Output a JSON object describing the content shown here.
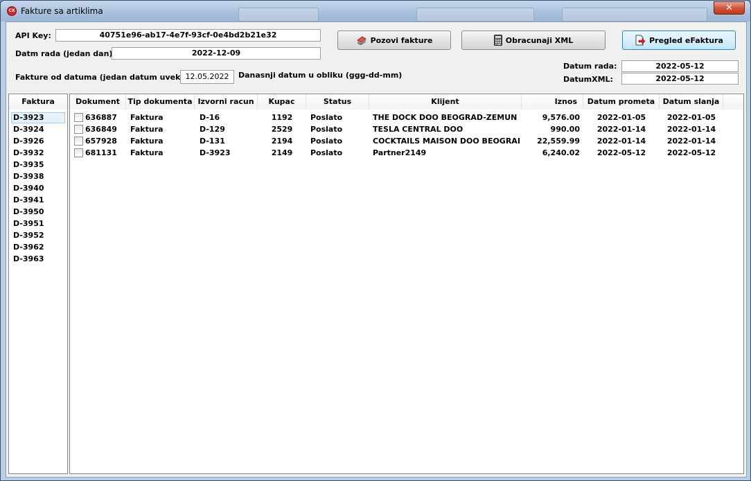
{
  "window": {
    "title": "Fakture sa artiklima",
    "close_symbol": "✕"
  },
  "form": {
    "api_key_label": "API Key:",
    "api_key_value": "40751e96-ab17-4e7f-93cf-0e4bd2b21e32",
    "datum_rada_label": "Datm rada (jedan dan)",
    "datum_rada_value": "2022-12-09",
    "fakture_od_label": "Fakture od datuma (jedan datum uvek):",
    "fakture_od_value": "12.05.2022",
    "danasnji_hint": "Danasnji datum u obliku (ggg-dd-mm)"
  },
  "toolbar": {
    "pozovi_label": "Pozovi fakture",
    "obracunaj_label": "Obracunaji XML",
    "pregled_label": "Pregled eFaktura"
  },
  "info": {
    "datum_rada_label": "Datum rada:",
    "datum_rada_value": "2022-05-12",
    "datum_xml_label": "DatumXML:",
    "datum_xml_value": "2022-05-12"
  },
  "faktura_list": {
    "header": "Faktura",
    "selected_index": 0,
    "items": [
      "D-3923",
      "D-3924",
      "D-3926",
      "D-3932",
      "D-3935",
      "D-3938",
      "D-3940",
      "D-3941",
      "D-3950",
      "D-3951",
      "D-3952",
      "D-3962",
      "D-3963"
    ]
  },
  "grid": {
    "columns": [
      "Dokument",
      "Tip dokumenta",
      "Izvorni racun",
      "Kupac",
      "Status",
      "Klijent",
      "Iznos",
      "Datum prometa",
      "Datum slanja"
    ],
    "rows": [
      {
        "checked": false,
        "dokument": "636887",
        "tip": "Faktura",
        "izvorni": "D-16",
        "kupac": "1192",
        "status": "Poslato",
        "klijent": "THE DOCK DOO BEOGRAD-ZEMUN",
        "iznos": "9,576.00",
        "prometa": "2022-01-05",
        "slanja": "2022-01-05"
      },
      {
        "checked": false,
        "dokument": "636849",
        "tip": "Faktura",
        "izvorni": "D-129",
        "kupac": "2529",
        "status": "Poslato",
        "klijent": "TESLA CENTRAL DOO",
        "iznos": "990.00",
        "prometa": "2022-01-14",
        "slanja": "2022-01-14"
      },
      {
        "checked": false,
        "dokument": "657928",
        "tip": "Faktura",
        "izvorni": "D-131",
        "kupac": "2194",
        "status": "Poslato",
        "klijent": "COCKTAILS MAISON DOO BEOGRAD...",
        "iznos": "22,559.99",
        "prometa": "2022-01-14",
        "slanja": "2022-01-14"
      },
      {
        "checked": false,
        "dokument": "681131",
        "tip": "Faktura",
        "izvorni": "D-3923",
        "kupac": "2149",
        "status": "Poslato",
        "klijent": "Partner2149",
        "iznos": "6,240.02",
        "prometa": "2022-05-12",
        "slanja": "2022-05-12"
      }
    ]
  },
  "icons": {
    "app": "app-icon",
    "pozovi": "invoice-stack-icon",
    "obracunaj": "calculator-icon",
    "pregled": "document-arrow-icon"
  }
}
